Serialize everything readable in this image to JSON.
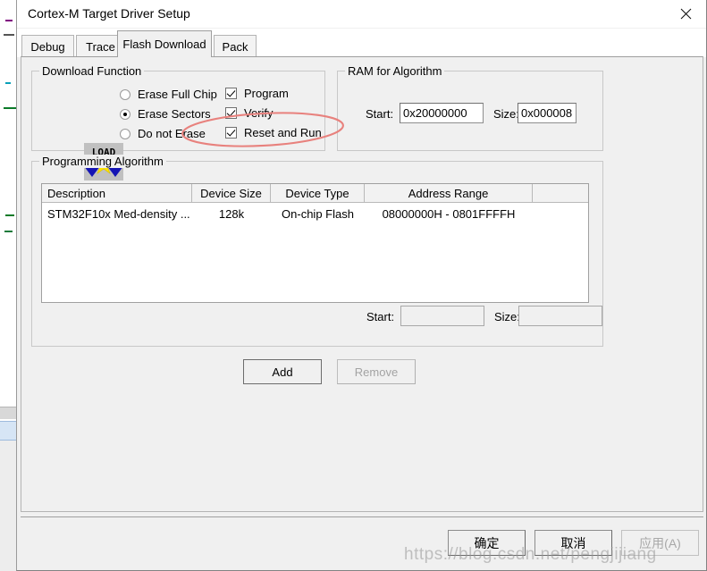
{
  "window": {
    "title": "Cortex-M Target Driver Setup",
    "close_icon": "close-icon"
  },
  "tabs": [
    {
      "label": "Debug",
      "active": false
    },
    {
      "label": "Trace",
      "active": false
    },
    {
      "label": "Flash Download",
      "active": true
    },
    {
      "label": "Pack",
      "active": false
    }
  ],
  "download_function": {
    "legend": "Download Function",
    "icon_text": "LOAD",
    "radios": [
      {
        "label": "Erase Full Chip",
        "selected": false
      },
      {
        "label": "Erase Sectors",
        "selected": true
      },
      {
        "label": "Do not Erase",
        "selected": false
      }
    ],
    "checkboxes": [
      {
        "label": "Program",
        "checked": true
      },
      {
        "label": "Verify",
        "checked": true
      },
      {
        "label": "Reset and Run",
        "checked": true
      }
    ]
  },
  "ram_for_algorithm": {
    "legend": "RAM for Algorithm",
    "start_label": "Start:",
    "start_value": "0x20000000",
    "size_label": "Size:",
    "size_value": "0x000008"
  },
  "programming_algorithm": {
    "legend": "Programming Algorithm",
    "columns": [
      "Description",
      "Device Size",
      "Device Type",
      "Address Range",
      ""
    ],
    "rows": [
      [
        "STM32F10x Med-density ...",
        "128k",
        "On-chip Flash",
        "08000000H - 0801FFFFH",
        ""
      ]
    ],
    "start_label": "Start:",
    "start_value": "",
    "size_label": "Size:",
    "size_value": "",
    "add_label": "Add",
    "remove_label": "Remove",
    "remove_enabled": false
  },
  "footer": {
    "ok_label": "确定",
    "cancel_label": "取消",
    "apply_label": "应用(A)",
    "apply_enabled": false
  },
  "annotation": {
    "color": "#e8817d",
    "shape": "ellipse",
    "target": "Reset and Run"
  },
  "watermark": {
    "text": "https://blog.csdn.net/pengjijiang"
  }
}
